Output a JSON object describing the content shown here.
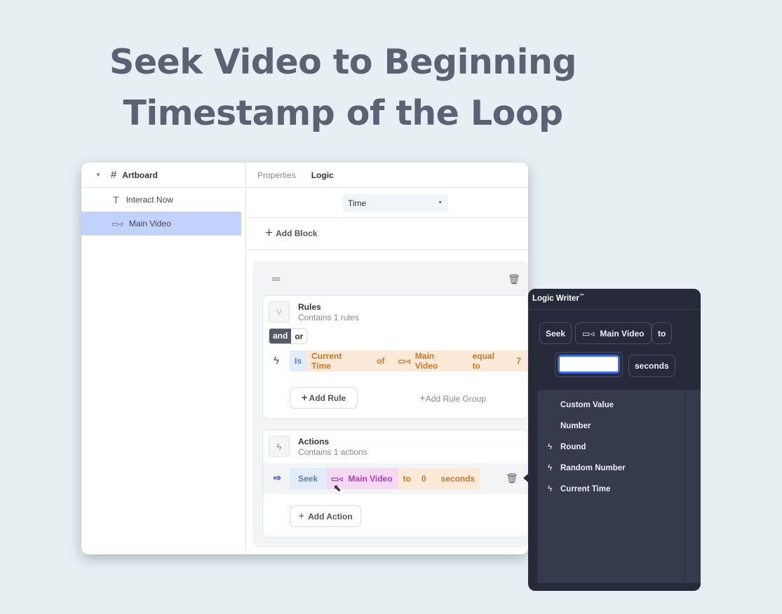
{
  "title_line1": "Seek Video to Beginning",
  "title_line2": "Timestamp of the Loop",
  "sidebar": {
    "root": "Artboard",
    "items": [
      {
        "label": "Interact Now",
        "icon": "text-icon"
      },
      {
        "label": "Main Video",
        "icon": "video-icon",
        "selected": true
      }
    ]
  },
  "tabs": [
    {
      "label": "Properties"
    },
    {
      "label": "Logic",
      "active": true
    }
  ],
  "trigger_select": "Time",
  "add_block": "Add Block",
  "rules": {
    "title": "Rules",
    "subtitle": "Contains 1 rules",
    "and": "and",
    "or": "or",
    "rule": {
      "is": "Is",
      "prop": "Current Time",
      "of": "of",
      "target": "Main Video",
      "op": "equal to",
      "value": "7"
    },
    "add_rule": "Add Rule",
    "add_rule_group": "Add Rule Group"
  },
  "actions": {
    "title": "Actions",
    "subtitle": "Contains 1 actions",
    "action": {
      "verb": "Seek",
      "target": "Main Video",
      "to": "to",
      "value": "0",
      "unit": "seconds"
    },
    "add_action": "Add Action"
  },
  "logic_writer": {
    "title": "Logic Writer",
    "tm": "™",
    "chips": {
      "seek": "Seek",
      "target": "Main Video",
      "to": "to",
      "unit": "seconds"
    },
    "input_value": "",
    "options": [
      {
        "label": "Custom Value"
      },
      {
        "label": "Number"
      },
      {
        "label": "Round",
        "icon": "lightning-icon"
      },
      {
        "label": "Random Number",
        "icon": "lightning-icon"
      },
      {
        "label": "Current Time",
        "icon": "lightning-icon"
      }
    ]
  },
  "colors": {
    "accent": "#3d6ce0",
    "selected": "#c2d3fb",
    "panel": "#272a3a",
    "rule_bg": "#fde9d7",
    "rule_text": "#c9782f",
    "magenta": "#b03fb5"
  }
}
